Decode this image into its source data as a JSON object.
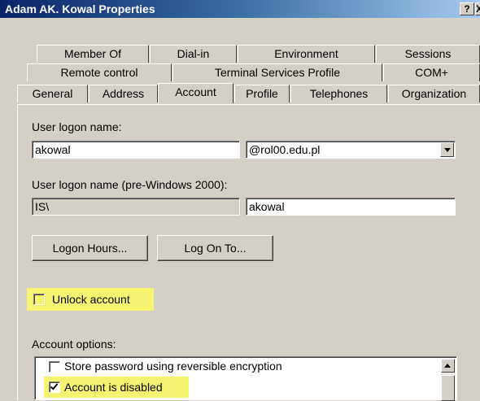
{
  "window": {
    "title": "Adam AK. Kowal Properties",
    "help_label": "?",
    "close_label": "X"
  },
  "tabs": {
    "row1": [
      "Member Of",
      "Dial-in",
      "Environment",
      "Sessions"
    ],
    "row2": [
      "Remote control",
      "Terminal Services Profile",
      "COM+"
    ],
    "row3": [
      "General",
      "Address",
      "Account",
      "Profile",
      "Telephones",
      "Organization"
    ],
    "active": "Account"
  },
  "account": {
    "logon_name_label": "User logon name:",
    "logon_name_value": "akowal",
    "domain_value": "@rol00.edu.pl",
    "pre2000_label": "User logon name (pre-Windows 2000):",
    "pre2000_domain": "IS\\",
    "pre2000_value": "akowal",
    "logon_hours_button": "Logon Hours...",
    "log_on_to_button": "Log On To...",
    "unlock_label": "Unlock account",
    "unlock_checked": false,
    "options_label": "Account options:",
    "options": [
      {
        "label": "Store password using reversible encryption",
        "checked": false
      },
      {
        "label": "Account is disabled",
        "checked": true
      }
    ]
  },
  "colors": {
    "highlight": "#f4f470",
    "titlebar": "#0a246a",
    "dialog_bg": "#d4d0c8"
  }
}
